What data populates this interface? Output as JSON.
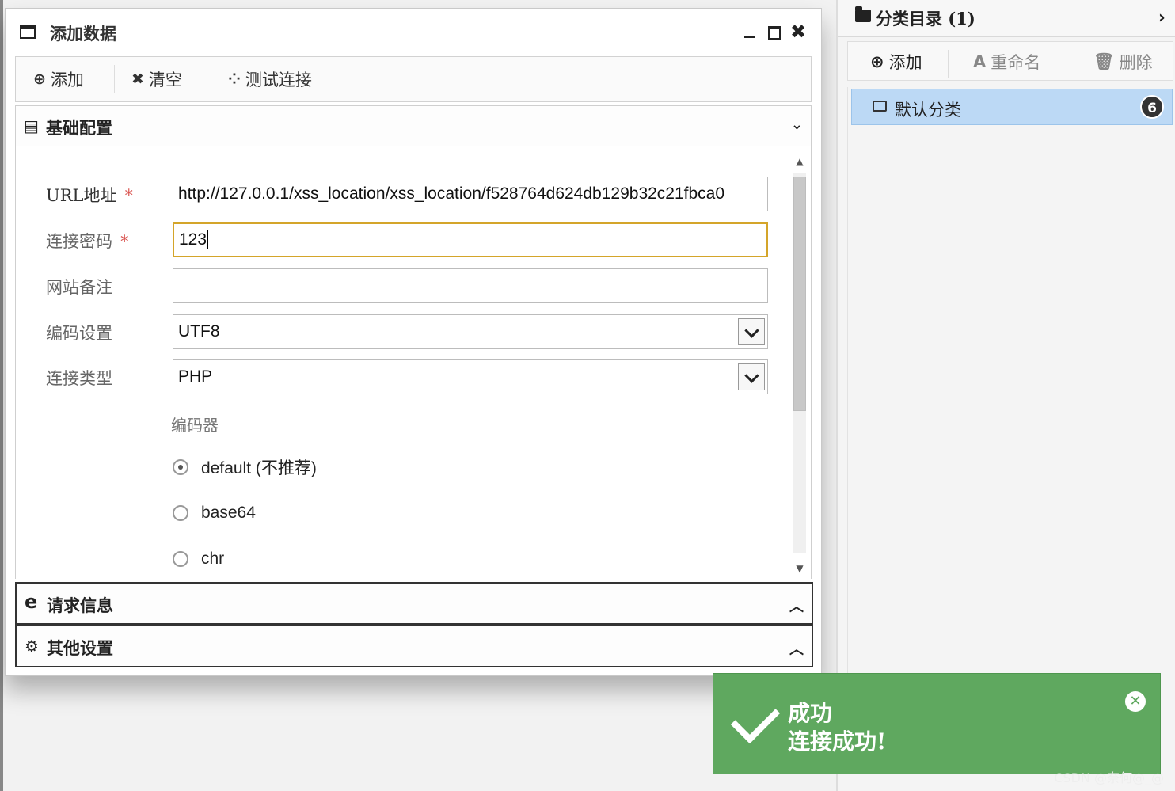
{
  "window": {
    "title": "添加数据"
  },
  "toolbar": {
    "add": "添加",
    "clear": "清空",
    "test": "测试连接"
  },
  "sections": {
    "basic": "基础配置",
    "request": "请求信息",
    "other": "其他设置"
  },
  "form": {
    "url_label": "URL地址",
    "url_value": "http://127.0.0.1/xss_location/xss_location/f528764d624db129b32c21fbca0",
    "password_label": "连接密码",
    "password_value": "123",
    "note_label": "网站备注",
    "note_value": "",
    "encoding_label": "编码设置",
    "encoding_value": "UTF8",
    "type_label": "连接类型",
    "type_value": "PHP",
    "required_mark": "*",
    "encoder_label": "编码器",
    "encoders": [
      {
        "label": "default (不推荐)",
        "selected": true
      },
      {
        "label": "base64",
        "selected": false
      },
      {
        "label": "chr",
        "selected": false
      }
    ]
  },
  "right_panel": {
    "title": "分类目录 (1)",
    "add": "添加",
    "rename": "重命名",
    "delete": "删除",
    "rename_icon_text": "A",
    "category": "默认分类",
    "category_count": "6"
  },
  "toast": {
    "title": "成功",
    "message": "连接成功!"
  },
  "watermark": "CSDN @奈何@_@",
  "colors": {
    "toast_bg": "#5fa85f",
    "selected_item": "#bcd9f5",
    "focus_border": "#d4a52a",
    "required": "#d9534f"
  }
}
